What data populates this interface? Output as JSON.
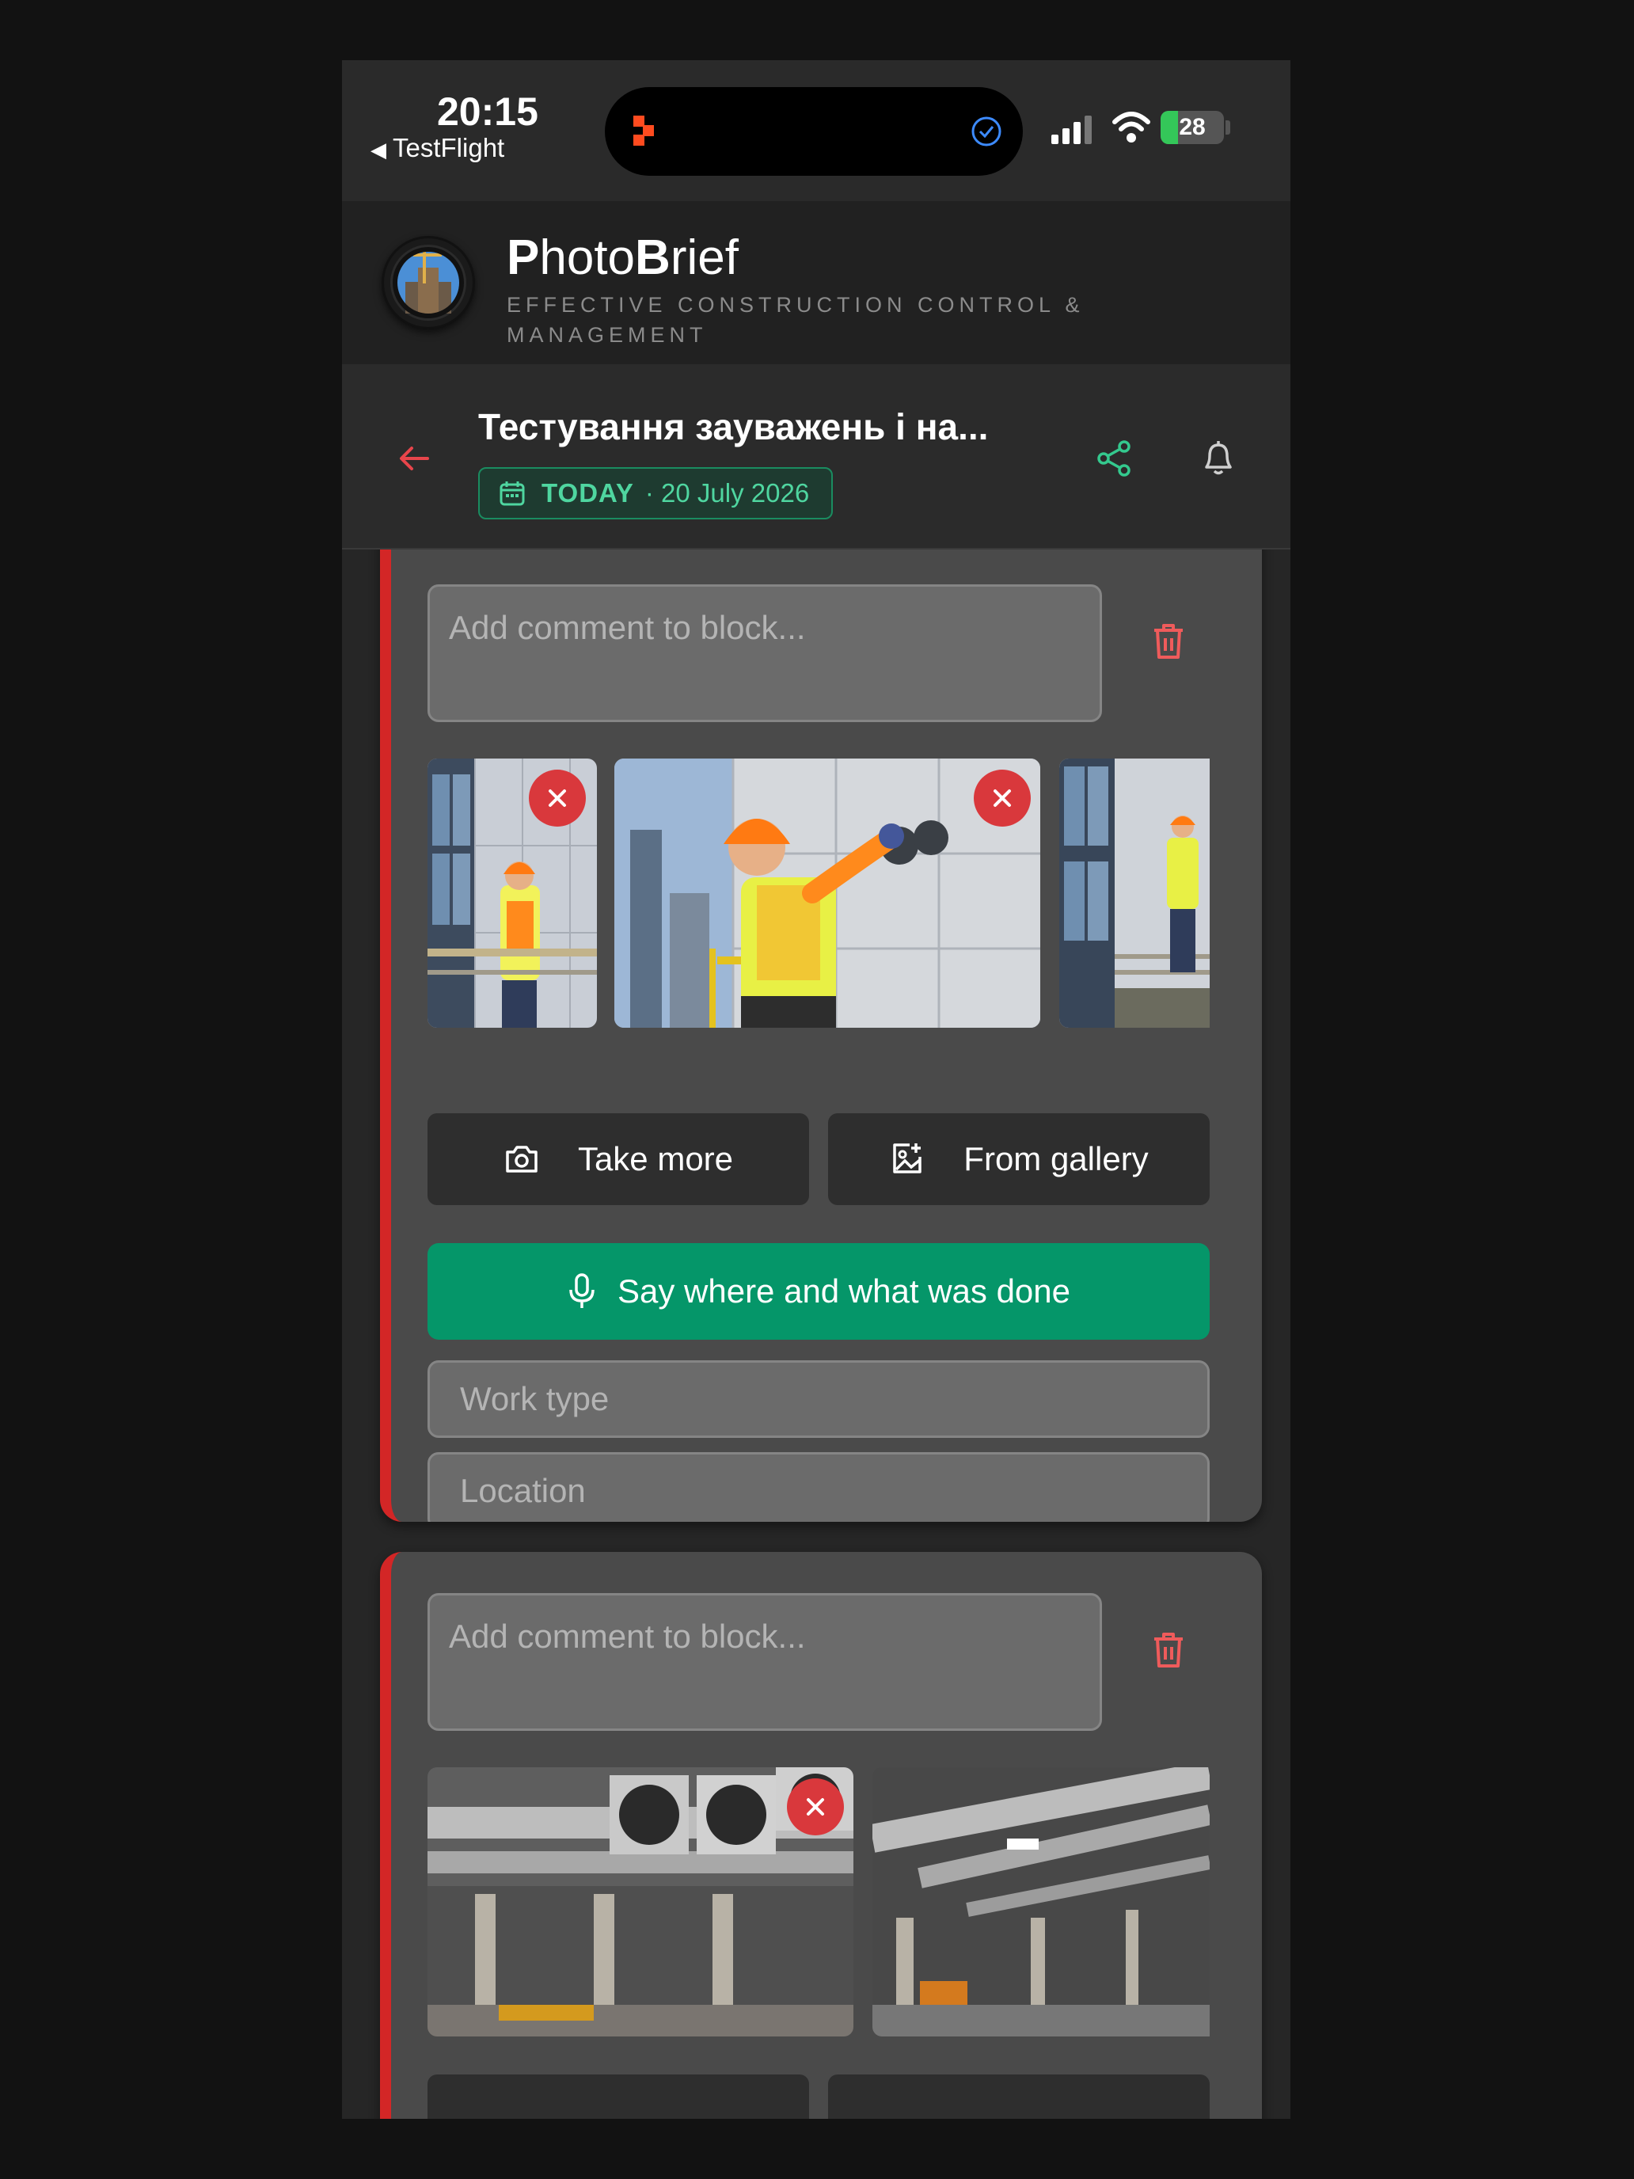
{
  "status_bar": {
    "time": "20:15",
    "back_app": "TestFlight",
    "battery": "28",
    "battery_level": 0.28
  },
  "app": {
    "brand_p": "P",
    "brand_hoto": "hoto",
    "brand_b": "B",
    "brand_rief": "rief",
    "tagline": "EFFECTIVE CONSTRUCTION CONTROL & MANAGEMENT"
  },
  "page": {
    "title": "Тестування зауважень і на...",
    "date_today": "TODAY",
    "date_value": "· 20 July 2026"
  },
  "blocks": [
    {
      "comment_placeholder": "Add comment to block...",
      "photos": [
        "worker-on-facade-1",
        "worker-on-facade-2",
        "worker-on-facade-3"
      ],
      "take_more": "Take more",
      "from_gallery": "From gallery",
      "voice_button": "Say where and what was done",
      "work_type_placeholder": "Work type",
      "location_placeholder": "Location"
    },
    {
      "comment_placeholder": "Add comment to block...",
      "photos": [
        "parking-ventilation-1",
        "parking-ventilation-2"
      ]
    }
  ],
  "colors": {
    "accent_red": "#d32626",
    "accent_green": "#059669",
    "chip_green": "#4fd6a0",
    "background": "#121212"
  },
  "icons": [
    "back-arrow-icon",
    "calendar-icon",
    "share-icon",
    "bell-icon",
    "trash-icon",
    "close-icon",
    "camera-icon",
    "gallery-add-icon",
    "microphone-icon"
  ]
}
